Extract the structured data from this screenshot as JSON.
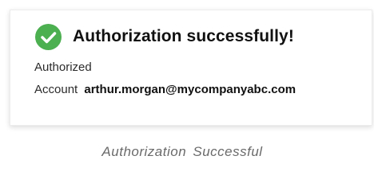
{
  "card": {
    "title": "Authorization successfully!",
    "status_text": "Authorized",
    "account_label": "Account",
    "account_value": "arthur.morgan@mycompanyabc.com",
    "icon": "check-circle-icon",
    "accent_color": "#4caf50"
  },
  "caption": {
    "text": "Authorization Successful"
  }
}
